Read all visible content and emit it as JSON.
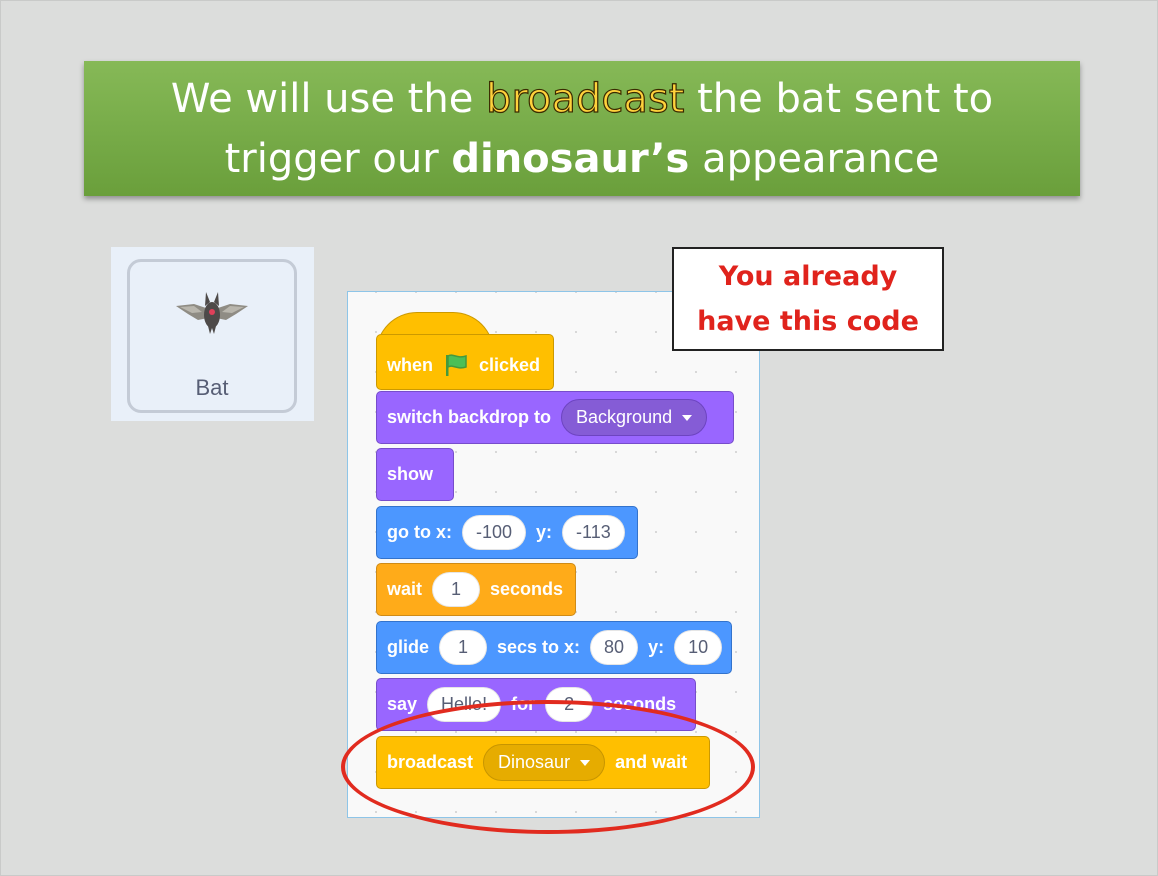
{
  "banner": {
    "line1_before": "We will use the ",
    "line1_highlight": "broadcast",
    "line1_after": " the bat sent to",
    "line2_before": "trigger our ",
    "line2_bold": "dinosaur’s",
    "line2_after": " appearance"
  },
  "sprite": {
    "name": "Bat",
    "icon": "bat-sprite-icon"
  },
  "note": {
    "line1": "You already",
    "line2": "have this code"
  },
  "blocks": {
    "hat": {
      "when": "when",
      "flag_icon": "green-flag-icon",
      "clicked": "clicked"
    },
    "switch_backdrop": {
      "label": "switch backdrop to",
      "value": "Background"
    },
    "show": {
      "label": "show"
    },
    "goto": {
      "label": "go to x:",
      "x": "-100",
      "y_label": "y:",
      "y": "-113"
    },
    "wait": {
      "label": "wait",
      "value": "1",
      "suffix": "seconds"
    },
    "glide": {
      "label": "glide",
      "secs": "1",
      "mid": "secs to x:",
      "x": "80",
      "y_label": "y:",
      "y": "10"
    },
    "say": {
      "label": "say",
      "message": "Hello!",
      "for": "for",
      "secs": "2",
      "suffix": "seconds"
    },
    "broadcast": {
      "label": "broadcast",
      "message": "Dinosaur",
      "suffix": "and wait"
    }
  },
  "colors": {
    "banner": "#76ab47",
    "highlight": "#ffd23c",
    "note_text": "#e0231c",
    "ellipse": "#e12b1f"
  }
}
